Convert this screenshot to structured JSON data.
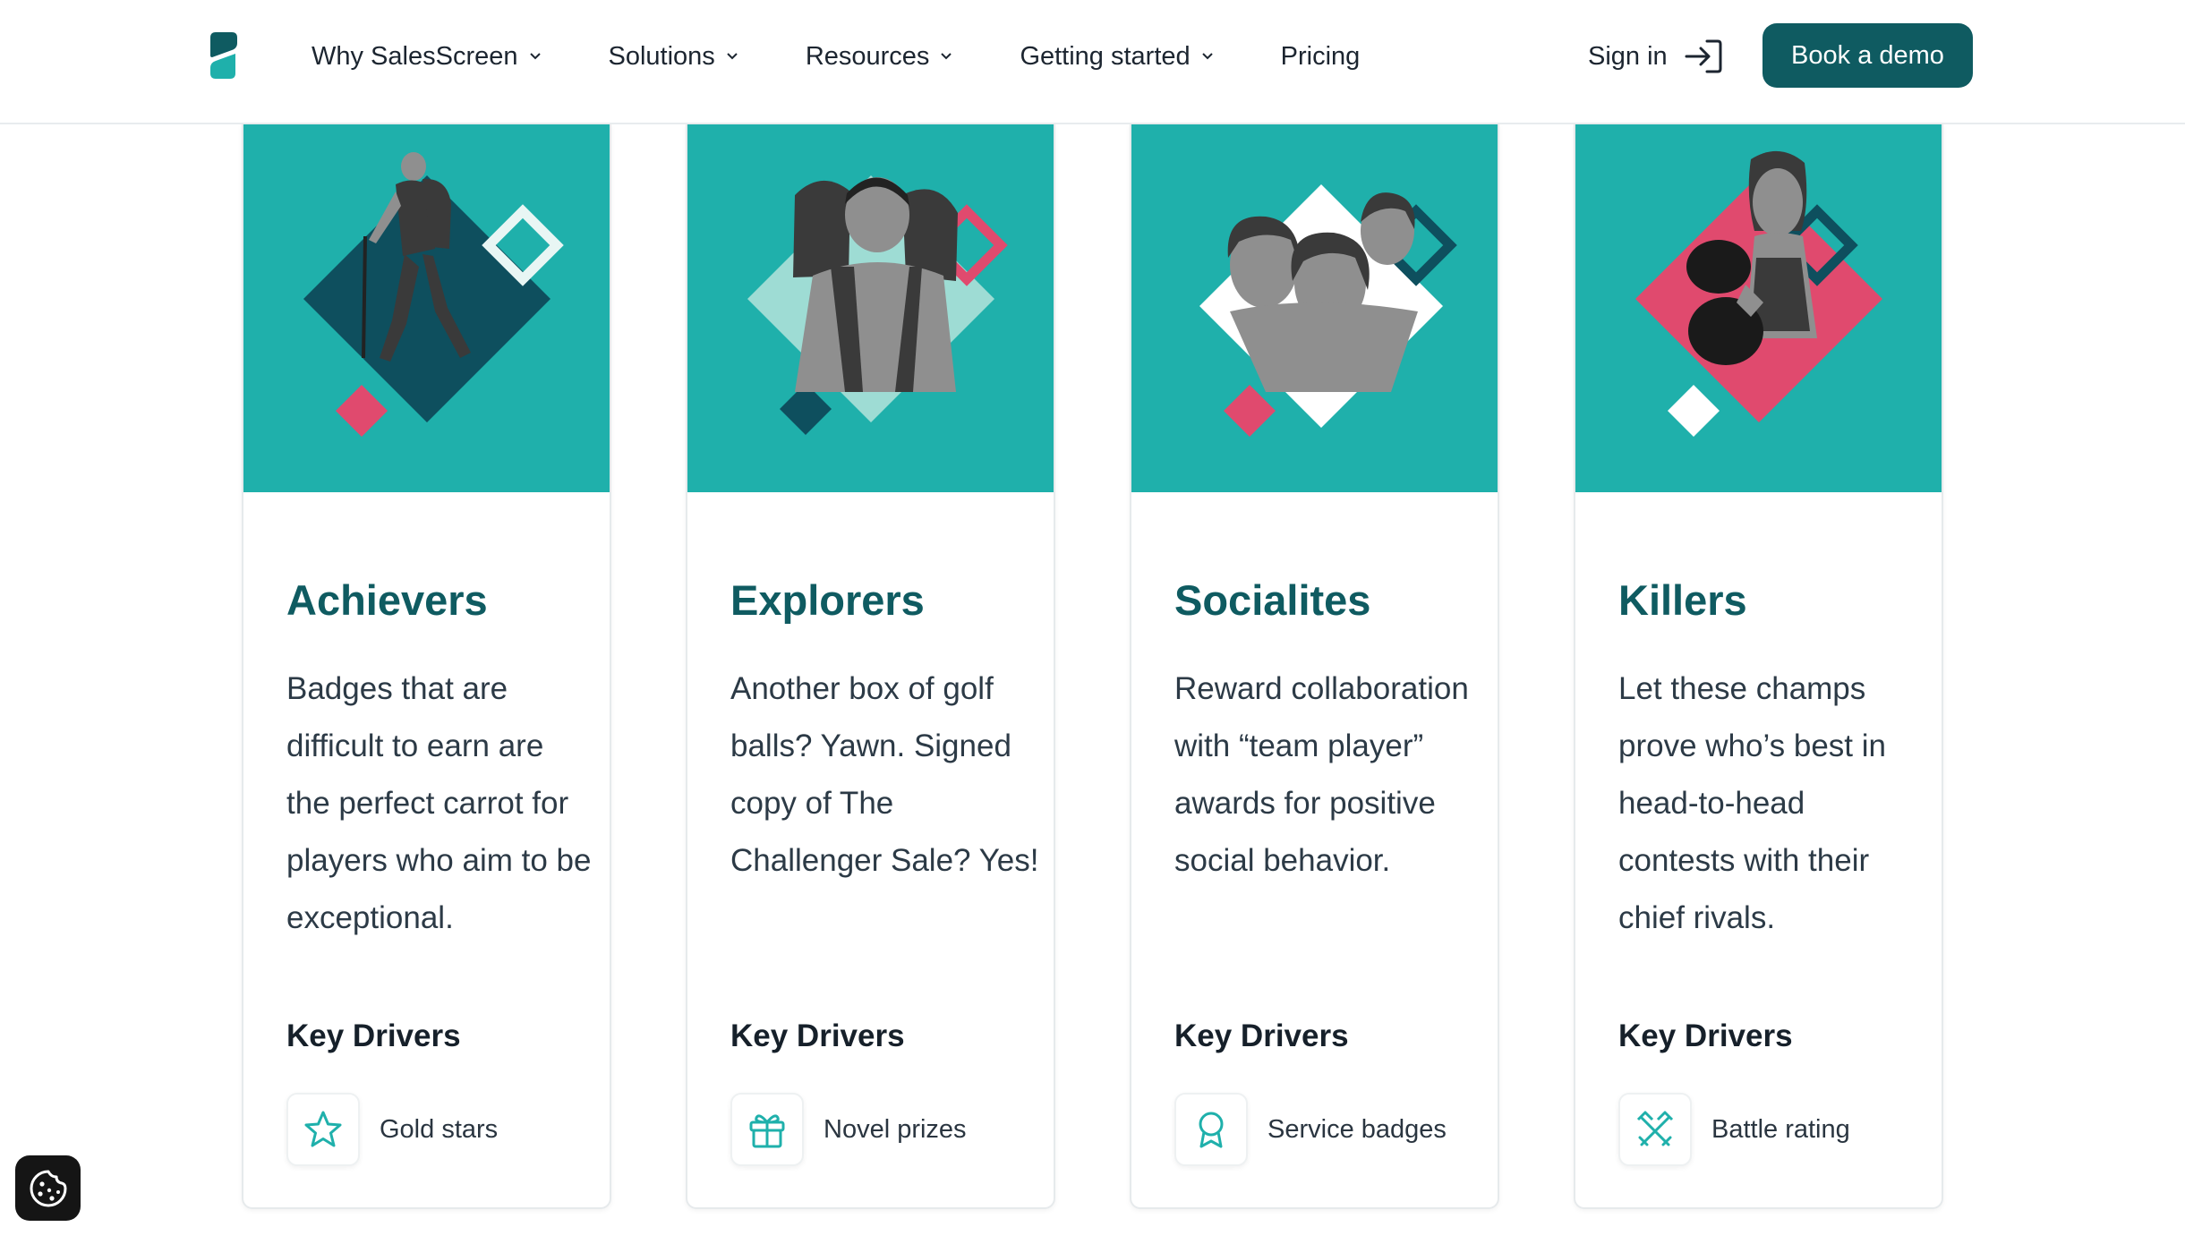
{
  "header": {
    "nav": [
      {
        "label": "Why SalesScreen"
      },
      {
        "label": "Solutions"
      },
      {
        "label": "Resources"
      },
      {
        "label": "Getting started"
      },
      {
        "label": "Pricing"
      }
    ],
    "sign_in": "Sign in",
    "demo_button": "Book a demo"
  },
  "colors": {
    "brand_dark": "#0f5b61",
    "teal": "#1fb0ab",
    "pink": "#e04a6e",
    "navy_teal": "#0e4f5e",
    "mint": "#9edcd4"
  },
  "cards": [
    {
      "title": "Achievers",
      "text": "Badges that are difficult to earn are the perfect carrot for players who aim to be exceptional.",
      "key_drivers": "Key Drivers",
      "driver": {
        "icon": "star-icon",
        "label": "Gold stars"
      }
    },
    {
      "title": "Explorers",
      "text": "Another box of golf balls? Yawn. Signed copy of The Challenger Sale? Yes!",
      "key_drivers": "Key Drivers",
      "driver": {
        "icon": "gift-icon",
        "label": "Novel prizes"
      }
    },
    {
      "title": "Socialites",
      "text": "Reward collaboration with “team player” awards for positive social behavior.",
      "key_drivers": "Key Drivers",
      "driver": {
        "icon": "award-ribbon-icon",
        "label": "Service badges"
      }
    },
    {
      "title": "Killers",
      "text": "Let these champs prove who’s best in head-to-head contests with their chief rivals.",
      "key_drivers": "Key Drivers",
      "driver": {
        "icon": "crossed-swords-icon",
        "label": "Battle rating"
      }
    }
  ],
  "cookie_button": {
    "icon": "cookie-icon"
  }
}
